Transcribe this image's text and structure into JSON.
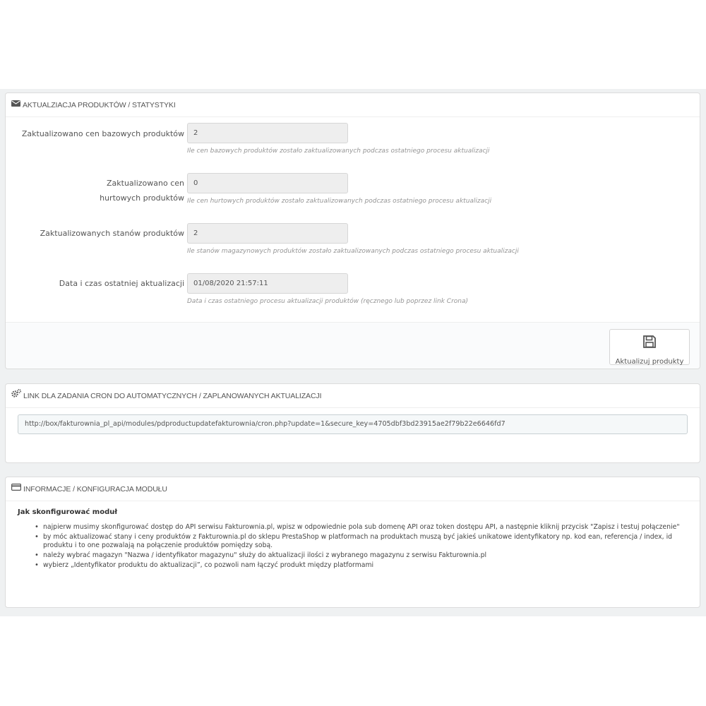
{
  "stats_panel": {
    "title": "AKTUALZIACJA PRODUKTÓW / STATYSTYKI",
    "icon": "envelope-icon",
    "fields": [
      {
        "label": "Zaktualizowano cen bazowych produktów",
        "value": "2",
        "help": "Ile cen bazowych produktów zostało zaktualizowanych podczas ostatniego procesu aktualizacji"
      },
      {
        "label": "Zaktualizowano cen hurtowych produktów",
        "value": "0",
        "help": "Ile cen hurtowych produktów zostało zaktualizowanych podczas ostatniego procesu aktualizacji"
      },
      {
        "label": "Zaktualizowanych stanów produktów",
        "value": "2",
        "help": "Ile stanów magazynowych produktów zostało zaktualizowanych podczas ostatniego procesu aktualizacji"
      },
      {
        "label": "Data i czas ostatniej aktualizacji",
        "value": "01/08/2020 21:57:11",
        "help": "Data i czas ostatniego procesu aktualizacji produktów (ręcznego lub poprzez link Crona)"
      }
    ],
    "update_button": {
      "label": "Aktualizuj produkty",
      "icon": "save-icon"
    }
  },
  "cron_panel": {
    "title": "LINK DLA ZADANIA CRON DO AUTOMATYCZNYCH / ZAPLANOWANYCH AKTUALIZACJI",
    "icon": "cogs-icon",
    "link": "http://box/fakturownia_pl_api/modules/pdproductupdatefakturownia/cron.php?update=1&secure_key=4705dbf3bd23915ae2f79b22e6646fd7"
  },
  "info_panel": {
    "title": "INFORMACJE / KONFIGURACJA MODUŁU",
    "icon": "credit-card-icon",
    "subtitle": "Jak skonfigurować moduł",
    "items": [
      "najpierw musimy skonfigurować dostęp do API serwisu Fakturownia.pl, wpisz w odpowiednie pola sub domenę API oraz token dostępu API, a następnie kliknij przycisk \"Zapisz i testuj połączenie\"",
      "by móc aktualizować stany i ceny produktów z Fakturownia.pl do sklepu PrestaShop w platformach na produktach muszą być jakieś unikatowe identyfikatory np. kod ean, referencja / index, id produktu i to one pozwalają na połączenie produktów pomiędzy sobą.",
      "należy wybrać magazyn \"Nazwa / identyfikator magazynu\" służy do aktualizacji ilości z wybranego magazynu z serwisu Fakturownia.pl",
      "wybierz „Identyfikator produktu do aktualizacji”, co pozwoli nam łączyć produkt między platformami"
    ]
  }
}
